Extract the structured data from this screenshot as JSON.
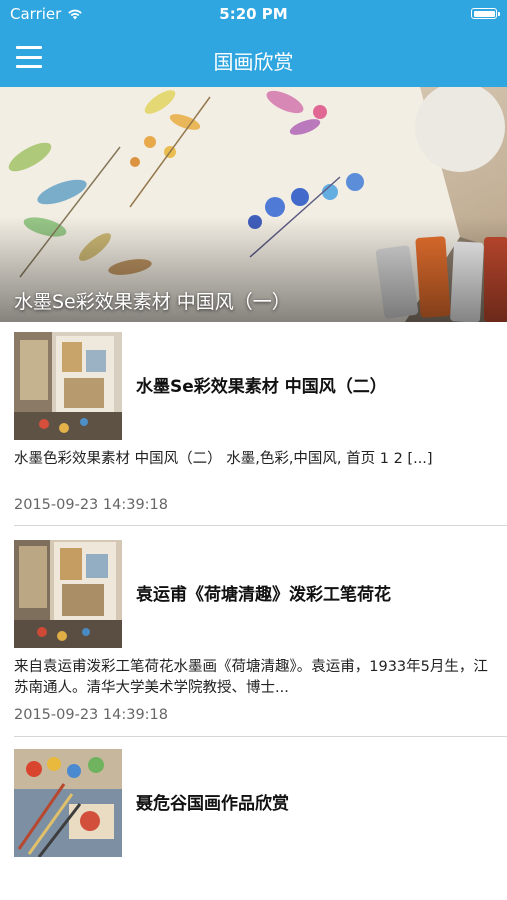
{
  "status_bar": {
    "carrier": "Carrier",
    "time": "5:20 PM",
    "icons": [
      "wifi-icon",
      "battery-icon"
    ]
  },
  "nav": {
    "title": "国画欣赏",
    "menu_icon": "hamburger-menu-icon"
  },
  "colors": {
    "nav_background": "#2fa6e0",
    "text_primary": "#111111",
    "text_secondary": "#666666",
    "divider": "#d6d6d6"
  },
  "hero": {
    "caption": "水墨Se彩效果素材 中国风（一）"
  },
  "articles": [
    {
      "title": "水墨Se彩效果素材 中国风（二）",
      "excerpt": "水墨色彩效果素材 中国风（二） 水墨,色彩,中国风, 首页  1 2 [...]",
      "date": "2015-09-23 14:39:18"
    },
    {
      "title": "袁运甫《荷塘清趣》泼彩工笔荷花",
      "excerpt": "来自袁运甫泼彩工笔荷花水墨画《荷塘清趣》。袁运甫，1933年5月生，江苏南通人。清华大学美术学院教授、博士...",
      "date": "2015-09-23 14:39:18"
    },
    {
      "title": "聂危谷国画作品欣赏"
    }
  ]
}
